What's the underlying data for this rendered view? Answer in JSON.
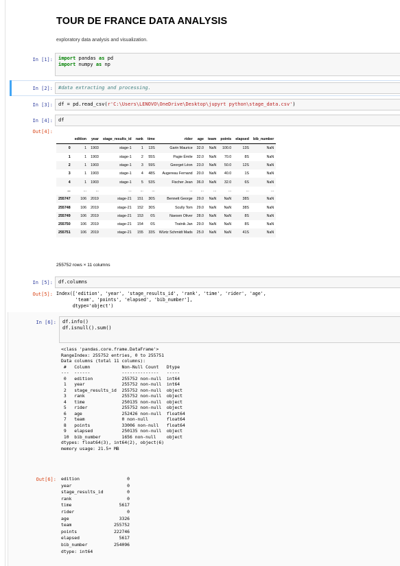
{
  "header": {
    "title": "TOUR DE FRANCE DATA ANALYSIS",
    "subtitle": "exploratory data analysis and visualization."
  },
  "cells": {
    "c1": {
      "prompt": "In [1]:",
      "line1_kw1": "import",
      "line1_mod": " pandas ",
      "line1_kw2": "as",
      "line1_alias": " pd",
      "line2_kw1": "import",
      "line2_mod": " numpy ",
      "line2_kw2": "as",
      "line2_alias": " np"
    },
    "c2": {
      "prompt": "In [2]:",
      "comment": "#data extracting and processing."
    },
    "c3": {
      "prompt": "In [3]:",
      "code_a": "df = pd.read_csv(",
      "code_str": "r'C:\\Users\\LENOVO\\OneDrive\\Desktop\\jupyrt python\\stage_data.csv'",
      "code_b": ")"
    },
    "c4": {
      "prompt": "In [4]:",
      "code": "df",
      "out_prompt": "Out[4]:"
    },
    "c5": {
      "prompt": "In [5]:",
      "code": "df.columns",
      "out_prompt": "Out[5]:",
      "output": "Index(['edition', 'year', 'stage_results_id', 'rank', 'time', 'rider', 'age',\n       'team', 'points', 'elapsed', 'bib_number'],\n      dtype='object')"
    },
    "c6": {
      "prompt": "In [6]:",
      "code": "df.info()\ndf.isnull().sum()",
      "out_prompt": "Out[6]:",
      "info_output": "<class 'pandas.core.frame.DataFrame'>\nRangeIndex: 255752 entries, 0 to 255751\nData columns (total 11 columns):\n #   Column            Non-Null Count   Dtype  \n---  ------            --------------   -----  \n 0   edition           255752 non-null  int64  \n 1   year              255752 non-null  int64  \n 2   stage_results_id  255752 non-null  object \n 3   rank              255752 non-null  object \n 4   time              250135 non-null  object \n 5   rider             255752 non-null  object \n 6   age               252426 non-null  float64\n 7   team              0 non-null       float64\n 8   points            33006 non-null   float64\n 9   elapsed           250135 non-null  object \n 10  bib_number        1656 non-null    object \ndtypes: float64(3), int64(2), object(6)\nmemory usage: 21.5+ MB",
      "null_output": "edition                  0\nyear                     0\nstage_results_id         0\nrank                     0\ntime                  5617\nrider                    0\nage                   3326\nteam                255752\npoints              222746\nelapsed               5617\nbib_number          254096\ndtype: int64"
    }
  },
  "dataframe": {
    "columns": [
      "edition",
      "year",
      "stage_results_id",
      "rank",
      "time",
      "rider",
      "age",
      "team",
      "points",
      "elapsed",
      "bib_number"
    ],
    "rows": [
      [
        "0",
        "1",
        "1903",
        "stage-1",
        "1",
        "13S",
        "Garin Maurice",
        "32.0",
        "NaN",
        "100.0",
        "13S",
        "NaN"
      ],
      [
        "1",
        "1",
        "1903",
        "stage-1",
        "2",
        "55S",
        "Pagie Émile",
        "32.0",
        "NaN",
        "70.0",
        "8S",
        "NaN"
      ],
      [
        "2",
        "1",
        "1903",
        "stage-1",
        "3",
        "59S",
        "Georget Léon",
        "23.0",
        "NaN",
        "50.0",
        "12S",
        "NaN"
      ],
      [
        "3",
        "1",
        "1903",
        "stage-1",
        "4",
        "48S",
        "Augereau Fernand",
        "20.0",
        "NaN",
        "40.0",
        "1S",
        "NaN"
      ],
      [
        "4",
        "1",
        "1903",
        "stage-1",
        "5",
        "53S",
        "Fischer Jean",
        "36.0",
        "NaN",
        "32.0",
        "6S",
        "NaN"
      ],
      [
        "...",
        "...",
        "...",
        "...",
        "...",
        "...",
        "...",
        "...",
        "...",
        "...",
        "...",
        "..."
      ],
      [
        "255747",
        "106",
        "2019",
        "stage-21",
        "151",
        "30S",
        "Bennett George",
        "29.0",
        "NaN",
        "NaN",
        "38S",
        "NaN"
      ],
      [
        "255748",
        "106",
        "2019",
        "stage-21",
        "152",
        "30S",
        "Scully Tom",
        "29.0",
        "NaN",
        "NaN",
        "38S",
        "NaN"
      ],
      [
        "255749",
        "106",
        "2019",
        "stage-21",
        "153",
        "0S",
        "Naesen Oliver",
        "28.0",
        "NaN",
        "NaN",
        "8S",
        "NaN"
      ],
      [
        "255750",
        "106",
        "2019",
        "stage-21",
        "154",
        "0S",
        "Tratnik Jan",
        "29.0",
        "NaN",
        "NaN",
        "8S",
        "NaN"
      ],
      [
        "255751",
        "106",
        "2019",
        "stage-21",
        "155",
        "33S",
        "Würtz Schmidt Mads",
        "25.0",
        "NaN",
        "NaN",
        "41S",
        "NaN"
      ]
    ],
    "summary": "255752 rows × 11 columns"
  }
}
